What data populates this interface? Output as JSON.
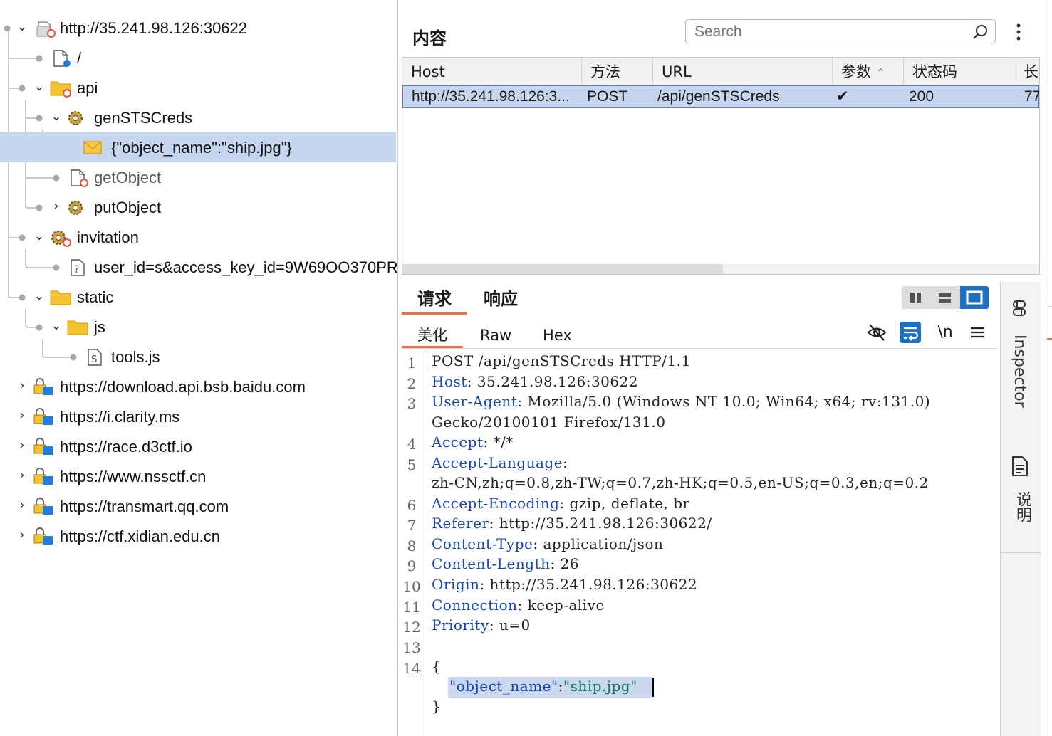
{
  "tree": {
    "items": [
      {
        "label": "http://35.241.98.126:30622",
        "expanded": true,
        "icon": "site-folder-icon"
      },
      {
        "label": "/",
        "icon": "page-icon"
      },
      {
        "label": "api",
        "expanded": true,
        "icon": "folder-icon"
      },
      {
        "label": "genSTSCreds",
        "expanded": true,
        "icon": "gear-icon"
      },
      {
        "label": "{\"object_name\":\"ship.jpg\"}",
        "icon": "envelope-icon",
        "selected": true
      },
      {
        "label": "getObject",
        "icon": "page-icon"
      },
      {
        "label": "putObject",
        "expanded": false,
        "icon": "gear-icon"
      },
      {
        "label": "invitation",
        "expanded": true,
        "icon": "gear-icon"
      },
      {
        "label": "user_id=s&access_key_id=9W69OO370PR",
        "icon": "unknown-file-icon"
      },
      {
        "label": "static",
        "expanded": true,
        "icon": "folder-icon"
      },
      {
        "label": "js",
        "expanded": true,
        "icon": "folder-icon"
      },
      {
        "label": "tools.js",
        "icon": "script-file-icon"
      },
      {
        "label": "https://download.api.bsb.baidu.com",
        "expanded": false,
        "icon": "locked-site-icon"
      },
      {
        "label": "https://i.clarity.ms",
        "expanded": false,
        "icon": "locked-site-icon"
      },
      {
        "label": "https://race.d3ctf.io",
        "expanded": false,
        "icon": "locked-site-icon"
      },
      {
        "label": "https://www.nssctf.cn",
        "expanded": false,
        "icon": "locked-site-icon"
      },
      {
        "label": "https://transmart.qq.com",
        "expanded": false,
        "icon": "locked-site-icon"
      },
      {
        "label": "https://ctf.xidian.edu.cn",
        "expanded": false,
        "icon": "locked-site-icon"
      }
    ]
  },
  "content": {
    "title": "内容",
    "search_placeholder": "Search"
  },
  "table": {
    "columns": [
      "Host",
      "方法",
      "URL",
      "参数",
      "状态码",
      "长"
    ],
    "rows": [
      {
        "host": "http://35.241.98.126:3...",
        "method": "POST",
        "url": "/api/genSTSCreds",
        "params": "✔",
        "status": "200",
        "length": "77"
      }
    ]
  },
  "message": {
    "tabs": [
      "请求",
      "响应"
    ],
    "subtabs": [
      "美化",
      "Raw",
      "Hex"
    ],
    "newline_label": "\\n",
    "lines": [
      {
        "n": "1",
        "text": "POST /api/genSTSCreds HTTP/1.1"
      },
      {
        "n": "2",
        "key": "Host",
        "val": ": 35.241.98.126:30622"
      },
      {
        "n": "3",
        "key": "User-Agent",
        "val": ": Mozilla/5.0 (Windows NT 10.0; Win64; x64; rv:131.0)"
      },
      {
        "n": "",
        "text": "Gecko/20100101 Firefox/131.0"
      },
      {
        "n": "4",
        "key": "Accept",
        "val": ": */*"
      },
      {
        "n": "5",
        "key": "Accept-Language",
        "val": ":"
      },
      {
        "n": "",
        "text": "zh-CN,zh;q=0.8,zh-TW;q=0.7,zh-HK;q=0.5,en-US;q=0.3,en;q=0.2"
      },
      {
        "n": "6",
        "key": "Accept-Encoding",
        "val": ": gzip, deflate, br"
      },
      {
        "n": "7",
        "key": "Referer",
        "val": ": http://35.241.98.126:30622/"
      },
      {
        "n": "8",
        "key": "Content-Type",
        "val": ": application/json"
      },
      {
        "n": "9",
        "key": "Content-Length",
        "val": ": 26"
      },
      {
        "n": "10",
        "key": "Origin",
        "val": ": http://35.241.98.126:30622"
      },
      {
        "n": "11",
        "key": "Connection",
        "val": ": keep-alive"
      },
      {
        "n": "12",
        "key": "Priority",
        "val": ": u=0"
      },
      {
        "n": "13",
        "text": ""
      },
      {
        "n": "14",
        "text": "{"
      }
    ],
    "json_key": "\"object_name\"",
    "json_colon": ":",
    "json_value": "\"ship.jpg\"",
    "json_close": "}"
  },
  "sidebar": {
    "inspector_label": "Inspector",
    "notes_label": "说明"
  },
  "colors": {
    "accent": "#e8704a",
    "selection": "#c6d6ee",
    "active_blue": "#1f6fc0",
    "header_key": "#1646b8"
  }
}
